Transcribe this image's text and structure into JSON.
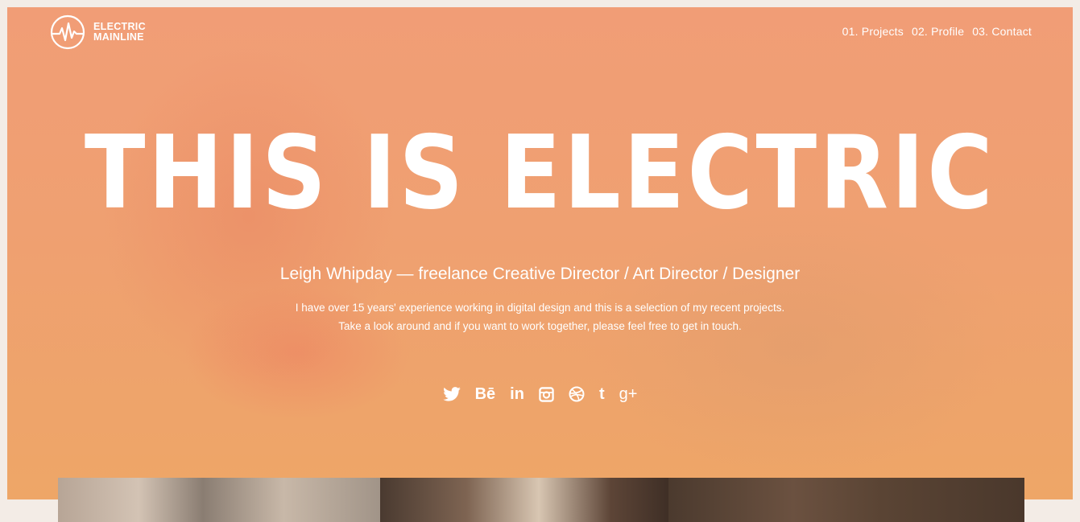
{
  "brand": {
    "line1": "ELECTRIC",
    "line2": "MAINLINE"
  },
  "nav": [
    {
      "label": "01. Projects"
    },
    {
      "label": "02. Profile"
    },
    {
      "label": "03. Contact"
    }
  ],
  "hero": {
    "headline": "THIS IS ELECTRIC",
    "subtitle": "Leigh Whipday — freelance Creative Director / Art Director / Designer",
    "description_line1": "I have over 15 years' experience working in digital design and this is a selection of my recent projects.",
    "description_line2": "Take a look around and if you want to work together, please feel free to get in touch."
  },
  "social": [
    {
      "icon": "twitter-icon"
    },
    {
      "icon": "behance-icon",
      "glyph": "Bē"
    },
    {
      "icon": "linkedin-icon",
      "glyph": "in"
    },
    {
      "icon": "instagram-icon"
    },
    {
      "icon": "dribbble-icon"
    },
    {
      "icon": "tumblr-icon",
      "glyph": "t"
    },
    {
      "icon": "google-plus-icon",
      "glyph": "g+"
    }
  ],
  "colors": {
    "hero_bg": "#f0a070",
    "page_bg": "#f3ece6",
    "text": "#ffffff"
  }
}
